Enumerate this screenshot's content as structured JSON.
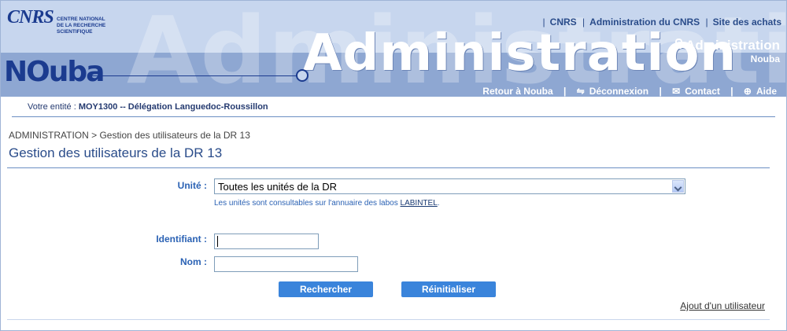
{
  "header": {
    "cnrs_logo": {
      "mark": "CNRS",
      "lines": [
        "CENTRE NATIONAL",
        "DE LA RECHERCHE",
        "SCIENTIFIQUE"
      ]
    },
    "nouba_logo": "NOuba",
    "banner_word": "Administration",
    "watermark_word": "Administration",
    "top_links": [
      "CNRS",
      "Administration du CNRS",
      "Site des achats"
    ],
    "section_title": "Administration",
    "section_subtitle": "Nouba",
    "nav_links": [
      {
        "label": "Retour à Nouba",
        "icon": "none"
      },
      {
        "label": "Déconnexion",
        "icon": "logout-icon"
      },
      {
        "label": "Contact",
        "icon": "mail-icon"
      },
      {
        "label": "Aide",
        "icon": "help-icon"
      }
    ]
  },
  "entity": {
    "prefix": "Votre entité :",
    "value": "MOY1300 -- Délégation Languedoc-Roussillon"
  },
  "breadcrumb": "ADMINISTRATION > Gestion des utilisateurs de la DR 13",
  "page_title": "Gestion des utilisateurs de la DR 13",
  "form": {
    "unite_label": "Unité :",
    "unite_selected": "Toutes les unités de la DR",
    "hint_text": "Les unités sont consultables sur l'annuaire des labos",
    "hint_link": "LABINTEL",
    "hint_end": ".",
    "identifiant_label": "Identifiant :",
    "identifiant_value": "",
    "nom_label": "Nom :",
    "nom_value": "",
    "search_button": "Rechercher",
    "reset_button": "Réinitialiser"
  },
  "add_user_link": "Ajout d'un utilisateur",
  "colors": {
    "header_light": "#c7d6ee",
    "header_band": "#8ea7d2",
    "brand_blue": "#1b3b8f",
    "label_blue": "#2b62b4",
    "button_blue": "#3a84db"
  }
}
